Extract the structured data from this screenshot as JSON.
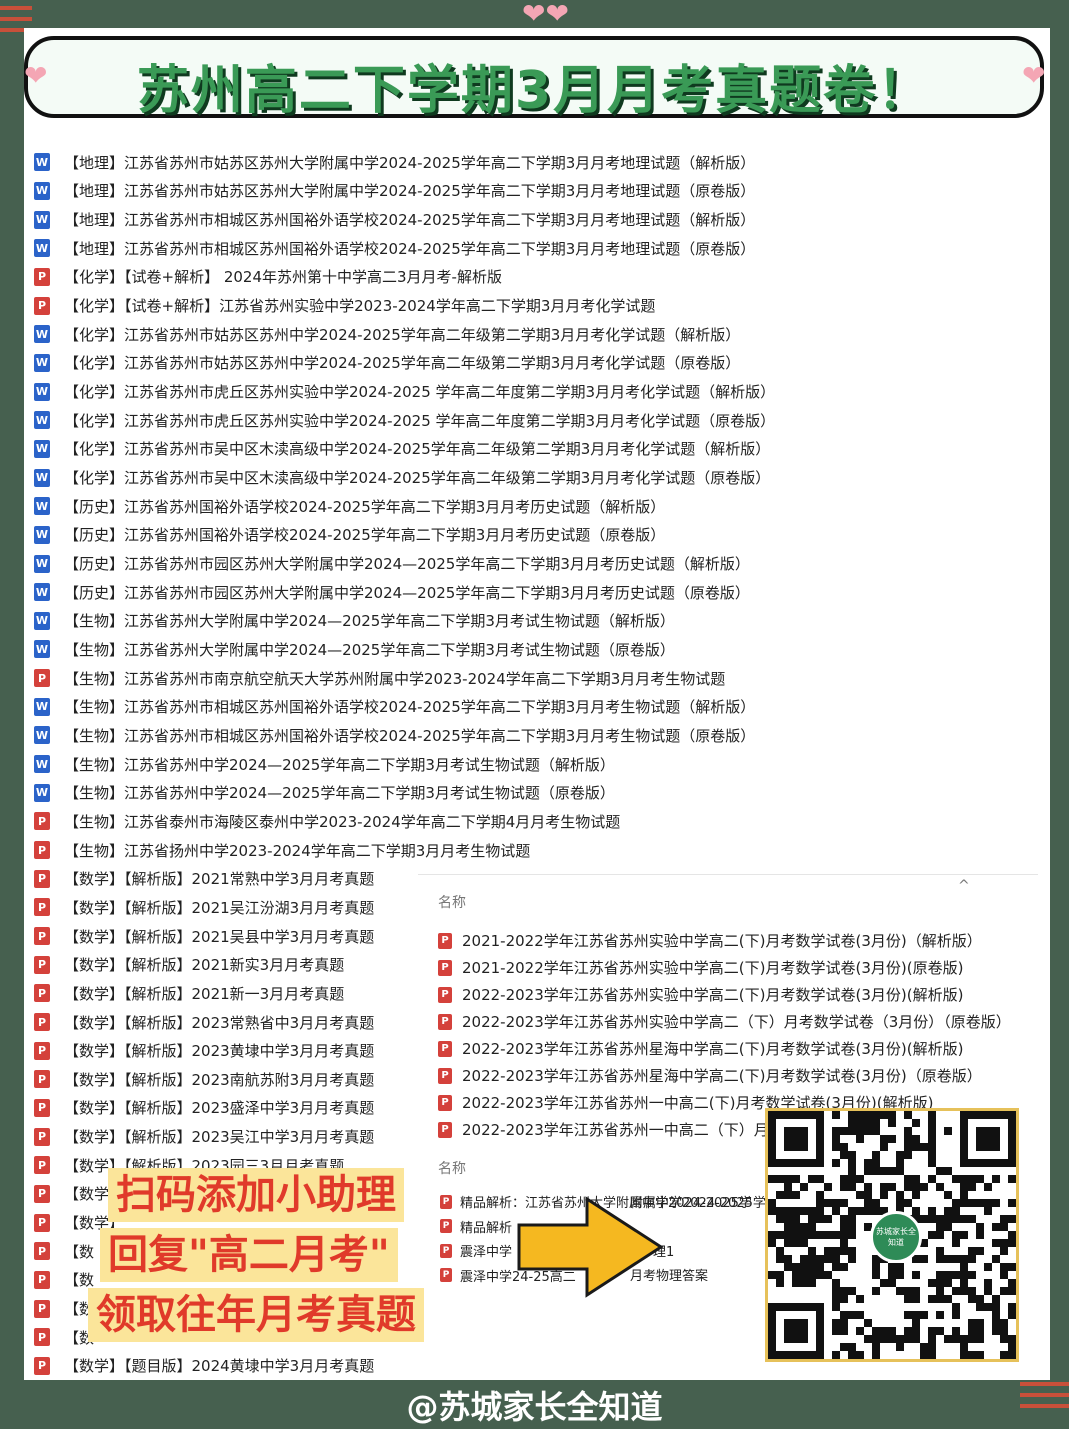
{
  "banner": {
    "title": "苏州高二下学期3月月考真题卷！"
  },
  "icons": {
    "word": "W",
    "pdf": "P"
  },
  "files": [
    {
      "type": "word",
      "name": "【地理】江苏省苏州市姑苏区苏州大学附属中学2024-2025学年高二下学期3月月考地理试题（解析版）"
    },
    {
      "type": "word",
      "name": "【地理】江苏省苏州市姑苏区苏州大学附属中学2024-2025学年高二下学期3月月考地理试题（原卷版）"
    },
    {
      "type": "word",
      "name": "【地理】江苏省苏州市相城区苏州国裕外语学校2024-2025学年高二下学期3月月考地理试题（解析版）"
    },
    {
      "type": "word",
      "name": "【地理】江苏省苏州市相城区苏州国裕外语学校2024-2025学年高二下学期3月月考地理试题（原卷版）"
    },
    {
      "type": "pdf",
      "name": "【化学】【试卷+解析】 2024年苏州第十中学高二3月月考-解析版"
    },
    {
      "type": "pdf",
      "name": "【化学】【试卷+解析】江苏省苏州实验中学2023-2024学年高二下学期3月月考化学试题"
    },
    {
      "type": "word",
      "name": "【化学】江苏省苏州市姑苏区苏州中学2024-2025学年高二年级第二学期3月月考化学试题（解析版）"
    },
    {
      "type": "word",
      "name": "【化学】江苏省苏州市姑苏区苏州中学2024-2025学年高二年级第二学期3月月考化学试题（原卷版）"
    },
    {
      "type": "word",
      "name": "【化学】江苏省苏州市虎丘区苏州实验中学2024-2025 学年高二年度第二学期3月月考化学试题（解析版）"
    },
    {
      "type": "word",
      "name": "【化学】江苏省苏州市虎丘区苏州实验中学2024-2025 学年高二年度第二学期3月月考化学试题（原卷版）"
    },
    {
      "type": "word",
      "name": "【化学】江苏省苏州市吴中区木渎高级中学2024-2025学年高二年级第二学期3月月考化学试题（解析版）"
    },
    {
      "type": "word",
      "name": "【化学】江苏省苏州市吴中区木渎高级中学2024-2025学年高二年级第二学期3月月考化学试题（原卷版）"
    },
    {
      "type": "word",
      "name": "【历史】江苏省苏州国裕外语学校2024-2025学年高二下学期3月月考历史试题（解析版）"
    },
    {
      "type": "word",
      "name": "【历史】江苏省苏州国裕外语学校2024-2025学年高二下学期3月月考历史试题（原卷版）"
    },
    {
      "type": "word",
      "name": "【历史】江苏省苏州市园区苏州大学附属中学2024—2025学年高二下学期3月月考历史试题（解析版）"
    },
    {
      "type": "word",
      "name": "【历史】江苏省苏州市园区苏州大学附属中学2024—2025学年高二下学期3月月考历史试题（原卷版）"
    },
    {
      "type": "word",
      "name": "【生物】江苏省苏州大学附属中学2024—2025学年高二下学期3月考试生物试题（解析版）"
    },
    {
      "type": "word",
      "name": "【生物】江苏省苏州大学附属中学2024—2025学年高二下学期3月考试生物试题（原卷版）"
    },
    {
      "type": "pdf",
      "name": "【生物】江苏省苏州市南京航空航天大学苏州附属中学2023-2024学年高二下学期3月月考生物试题"
    },
    {
      "type": "word",
      "name": "【生物】江苏省苏州市相城区苏州国裕外语学校2024-2025学年高二下学期3月月考生物试题（解析版）"
    },
    {
      "type": "word",
      "name": "【生物】江苏省苏州市相城区苏州国裕外语学校2024-2025学年高二下学期3月月考生物试题（原卷版）"
    },
    {
      "type": "word",
      "name": "【生物】江苏省苏州中学2024—2025学年高二下学期3月考试生物试题（解析版）"
    },
    {
      "type": "word",
      "name": "【生物】江苏省苏州中学2024—2025学年高二下学期3月考试生物试题（原卷版）"
    },
    {
      "type": "pdf",
      "name": "【生物】江苏省泰州市海陵区泰州中学2023-2024学年高二下学期4月月考生物试题"
    },
    {
      "type": "pdf",
      "name": "【生物】江苏省扬州中学2023-2024学年高二下学期3月月考生物试题"
    },
    {
      "type": "pdf",
      "name": "【数学】【解析版】2021常熟中学3月月考真题"
    },
    {
      "type": "pdf",
      "name": "【数学】【解析版】2021吴江汾湖3月月考真题"
    },
    {
      "type": "pdf",
      "name": "【数学】【解析版】2021吴县中学3月月考真题"
    },
    {
      "type": "pdf",
      "name": "【数学】【解析版】2021新实3月月考真题"
    },
    {
      "type": "pdf",
      "name": "【数学】【解析版】2021新一3月月考真题"
    },
    {
      "type": "pdf",
      "name": "【数学】【解析版】2023常熟省中3月月考真题"
    },
    {
      "type": "pdf",
      "name": "【数学】【解析版】2023黄埭中学3月月考真题"
    },
    {
      "type": "pdf",
      "name": "【数学】【解析版】2023南航苏附3月月考真题"
    },
    {
      "type": "pdf",
      "name": "【数学】【解析版】2023盛泽中学3月月考真题"
    },
    {
      "type": "pdf",
      "name": "【数学】【解析版】2023吴江中学3月月考真题"
    },
    {
      "type": "pdf",
      "name": "【数学】【解析版】2023园三3月月考真题"
    },
    {
      "type": "pdf",
      "name": "【数学】"
    },
    {
      "type": "pdf",
      "name": "【数学】"
    },
    {
      "type": "pdf",
      "name": "【数"
    },
    {
      "type": "pdf",
      "name": "【数"
    },
    {
      "type": "pdf",
      "name": "【数"
    },
    {
      "type": "pdf",
      "name": "【数"
    },
    {
      "type": "pdf",
      "name": "【数学】【题目版】2024黄埭中学3月月考真题"
    }
  ],
  "panel": {
    "header1": "名称",
    "items1": [
      "2021-2022学年江苏省苏州实验中学高二(下)月考数学试卷(3月份)（解析版）",
      "2021-2022学年江苏省苏州实验中学高二(下)月考数学试卷(3月份)(原卷版)",
      "2022-2023学年江苏省苏州实验中学高二(下)月考数学试卷(3月份)(解析版)",
      "2022-2023学年江苏省苏州实验中学高二（下）月考数学试卷（3月份）（原卷版）",
      "2022-2023学年江苏省苏州星海中学高二(下)月考数学试卷(3月份)(解析版)",
      "2022-2023学年江苏省苏州星海中学高二(下)月考数学试卷(3月份)（原卷版）",
      "2022-2023学年江苏省苏州一中高二(下)月考数学试卷(3月份)(解析版)",
      "2022-2023学年江苏省苏州一中高二（下）月"
    ],
    "header2": "名称",
    "items2": [
      "精品解析：江苏省苏州大学附属中学2024-2025学",
      "精品解析",
      "震泽中学",
      "震泽中学24-25高二"
    ],
    "items2_tail": [
      "附属中学2024-2025学",
      "理1",
      "月考物理答案"
    ]
  },
  "cta": {
    "line1": "扫码添加小助理",
    "line2": "回复\"高二月考\"",
    "line3": "领取往年月考真题"
  },
  "qr": {
    "badge": "苏城家长全知道"
  },
  "footer": {
    "handle": "@苏城家长全知道"
  },
  "colors": {
    "background": "#46604f",
    "title_green": "#3a9a56",
    "cta_red": "#e03a2a",
    "cta_bg": "#fbe59a",
    "arrow": "#f5b820"
  }
}
